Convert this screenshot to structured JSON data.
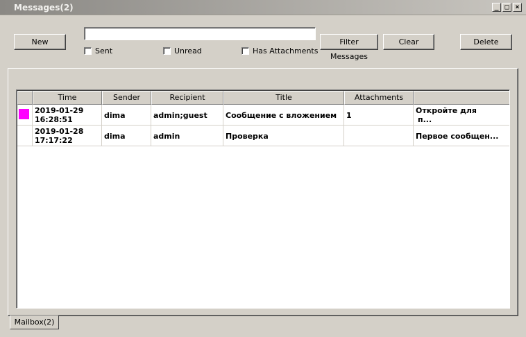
{
  "window": {
    "title": "Messages(2)",
    "minimize": "_",
    "maximize": "□",
    "close": "×"
  },
  "toolbar": {
    "new_label": "New",
    "search_value": "",
    "filter_label": "Filter Messages",
    "clear_label": "Clear",
    "delete_label": "Delete",
    "checkboxes": {
      "sent": "Sent",
      "unread": "Unread",
      "attachments": "Has Attachments"
    }
  },
  "table": {
    "columns": [
      "",
      "Time",
      "Sender",
      "Recipient",
      "Title",
      "Attachments",
      ""
    ],
    "rows": [
      {
        "marker_color": "#ff00ff",
        "date": "2019-01-29",
        "time": "16:28:51",
        "sender": "dima",
        "recipient": "admin;guest",
        "title": "Сообщение с вложением",
        "attachments": "1",
        "preview_line1": "Откройте для",
        "preview_line2": "п..."
      },
      {
        "marker_color": "",
        "date": "2019-01-28",
        "time": "17:17:22",
        "sender": "dima",
        "recipient": "admin",
        "title": "Проверка",
        "attachments": "",
        "preview_line1": "Первое сообщен...",
        "preview_line2": ""
      }
    ]
  },
  "tabs": [
    {
      "label": "Mailbox(2)"
    }
  ]
}
